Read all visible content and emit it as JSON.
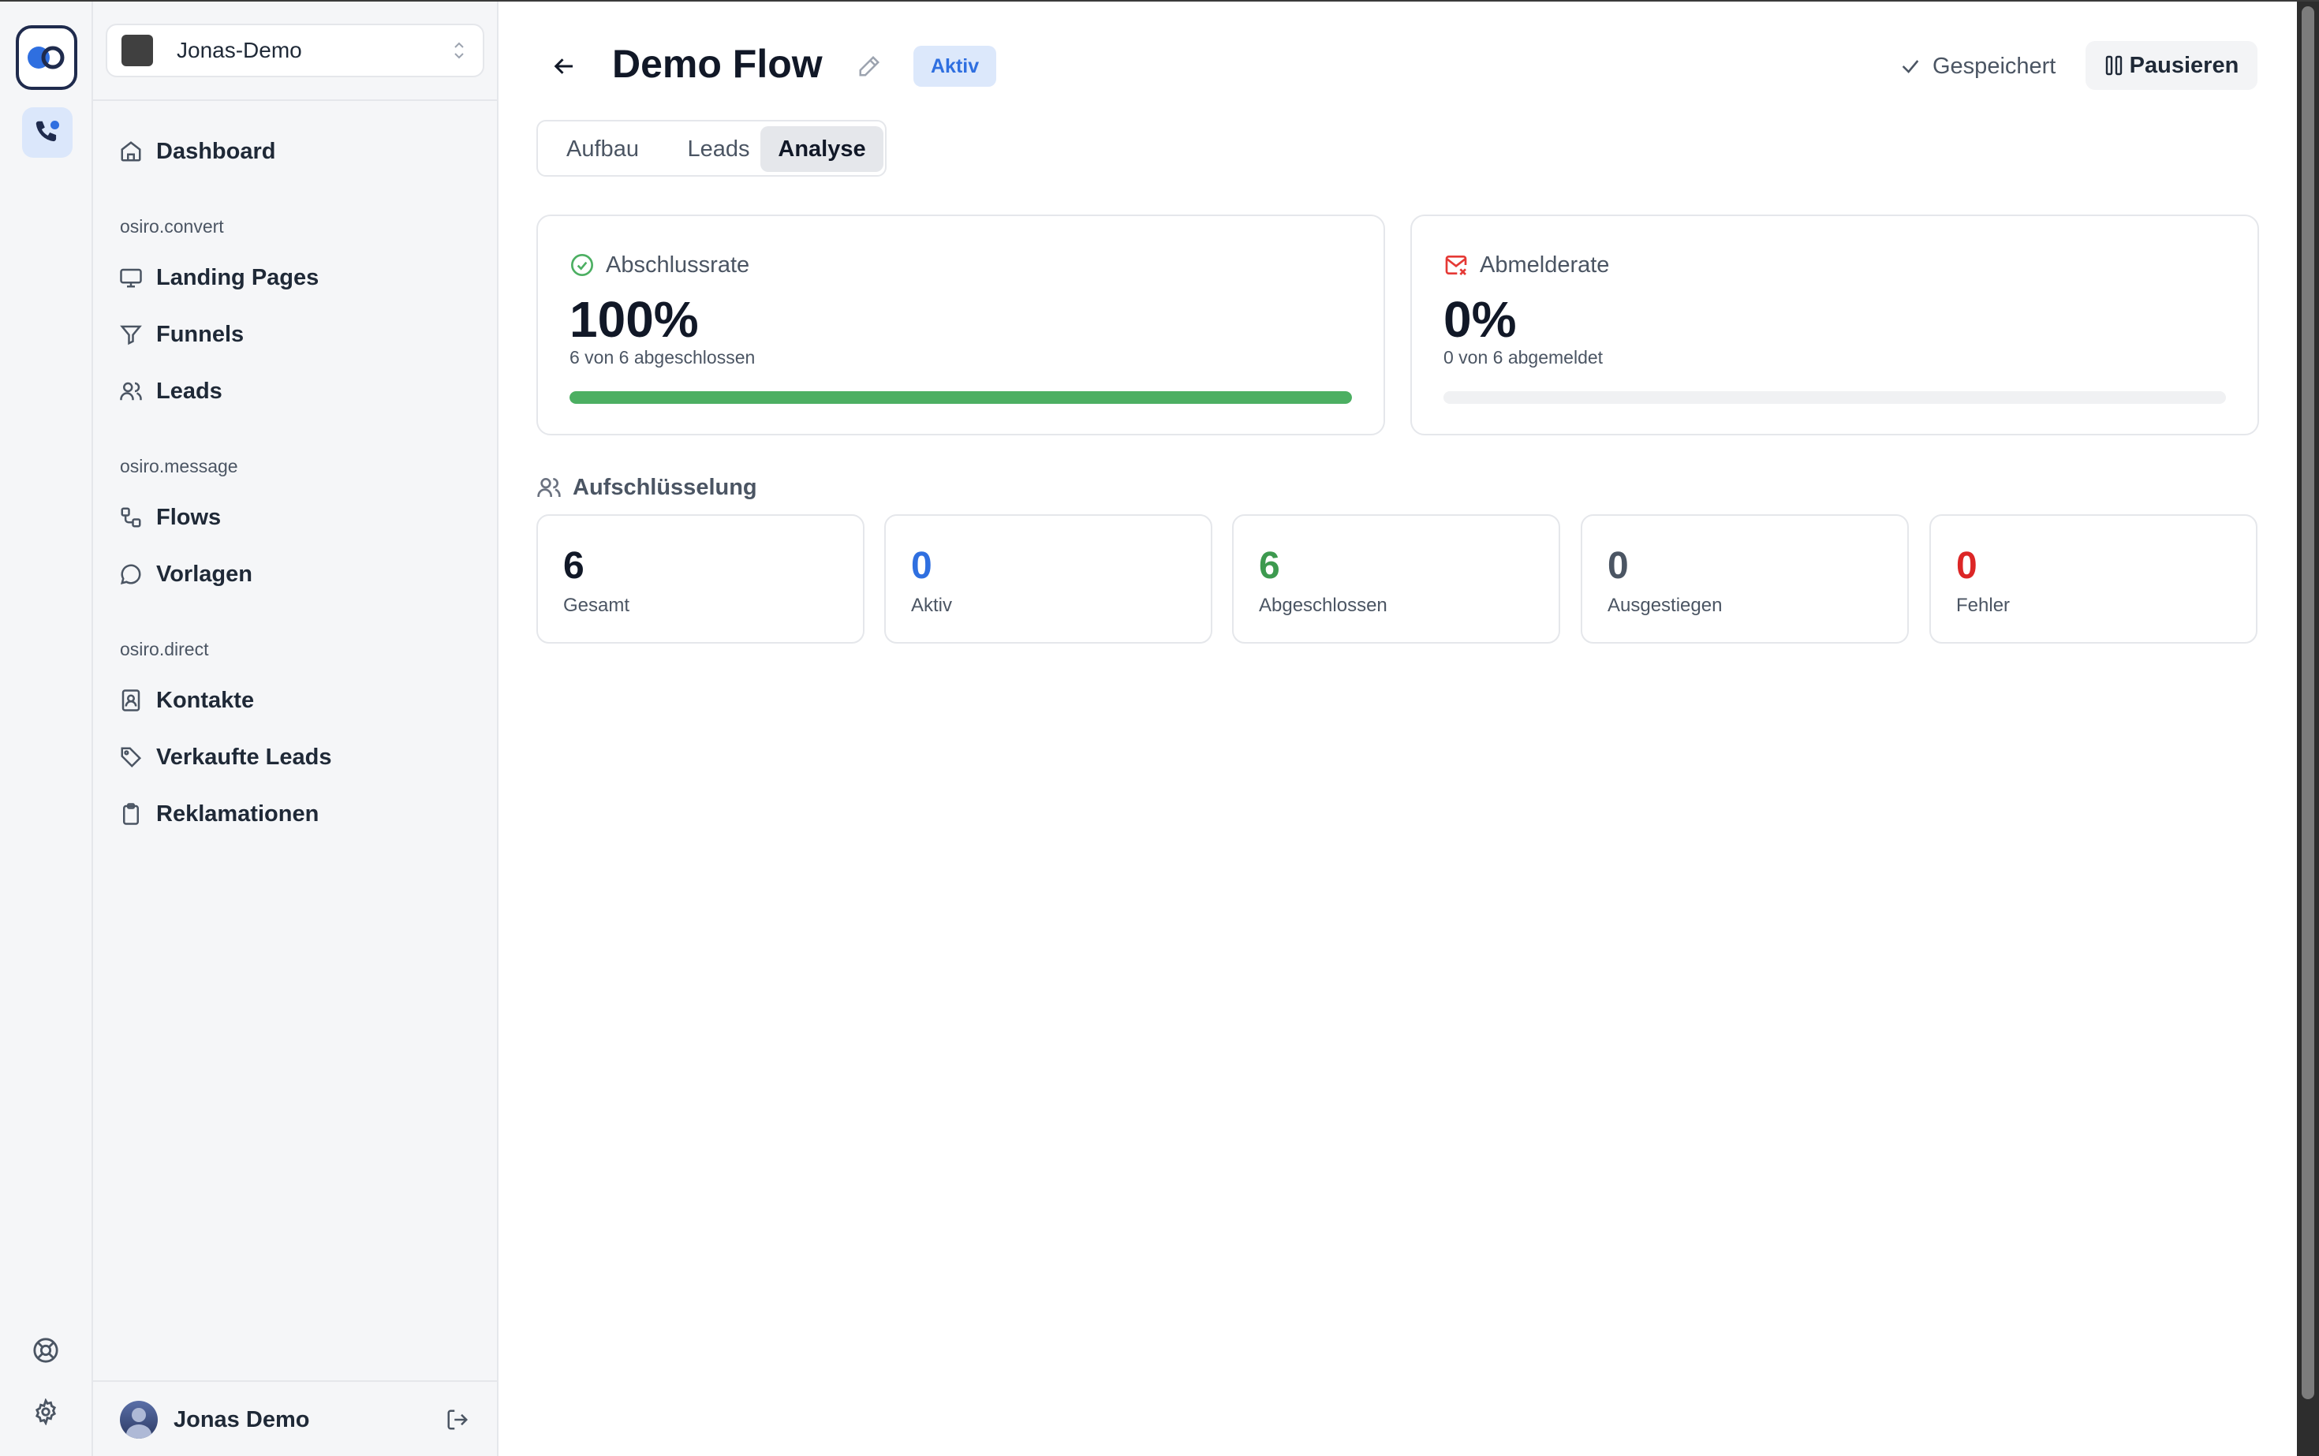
{
  "workspace": {
    "name": "Jonas-Demo"
  },
  "nav": {
    "dashboard": "Dashboard",
    "sections": [
      {
        "label": "osiro.convert",
        "items": [
          "Landing Pages",
          "Funnels",
          "Leads"
        ]
      },
      {
        "label": "osiro.message",
        "items": [
          "Flows",
          "Vorlagen"
        ]
      },
      {
        "label": "osiro.direct",
        "items": [
          "Kontakte",
          "Verkaufte Leads",
          "Reklamationen"
        ]
      }
    ]
  },
  "user": {
    "name": "Jonas Demo"
  },
  "header": {
    "title": "Demo Flow",
    "status_badge": "Aktiv",
    "saved_label": "Gespeichert",
    "pause_label": "Pausieren"
  },
  "tabs": [
    {
      "label": "Aufbau",
      "active": false
    },
    {
      "label": "Leads",
      "active": false
    },
    {
      "label": "Analyse",
      "active": true
    }
  ],
  "metrics": {
    "completion": {
      "label": "Abschlussrate",
      "value": "100%",
      "sub": "6 von 6 abgeschlossen",
      "progress": 1.0,
      "color": "#4caf62"
    },
    "unsubscribe": {
      "label": "Abmelderate",
      "value": "0%",
      "sub": "0 von 6 abgemeldet",
      "progress": 0.0,
      "color": "#e53935"
    }
  },
  "breakdown": {
    "title": "Aufschlüsselung",
    "stats": [
      {
        "value": "6",
        "label": "Gesamt",
        "color": "#111827"
      },
      {
        "value": "0",
        "label": "Aktiv",
        "color": "#2f6fe0"
      },
      {
        "value": "6",
        "label": "Abgeschlossen",
        "color": "#3d9a4f"
      },
      {
        "value": "0",
        "label": "Ausgestiegen",
        "color": "#4b5563"
      },
      {
        "value": "0",
        "label": "Fehler",
        "color": "#dc2626"
      }
    ]
  },
  "icons": {
    "rail": [
      "app-logo-icon",
      "phone-icon",
      "help-icon",
      "settings-icon"
    ],
    "nav": [
      "home-icon",
      "monitor-icon",
      "filter-icon",
      "users-icon",
      "workflow-icon",
      "message-circle-icon",
      "contact-book-icon",
      "tag-icon",
      "clipboard-icon"
    ]
  },
  "colors": {
    "accent": "#2f6fe0",
    "success": "#4caf62",
    "danger": "#e53935"
  }
}
